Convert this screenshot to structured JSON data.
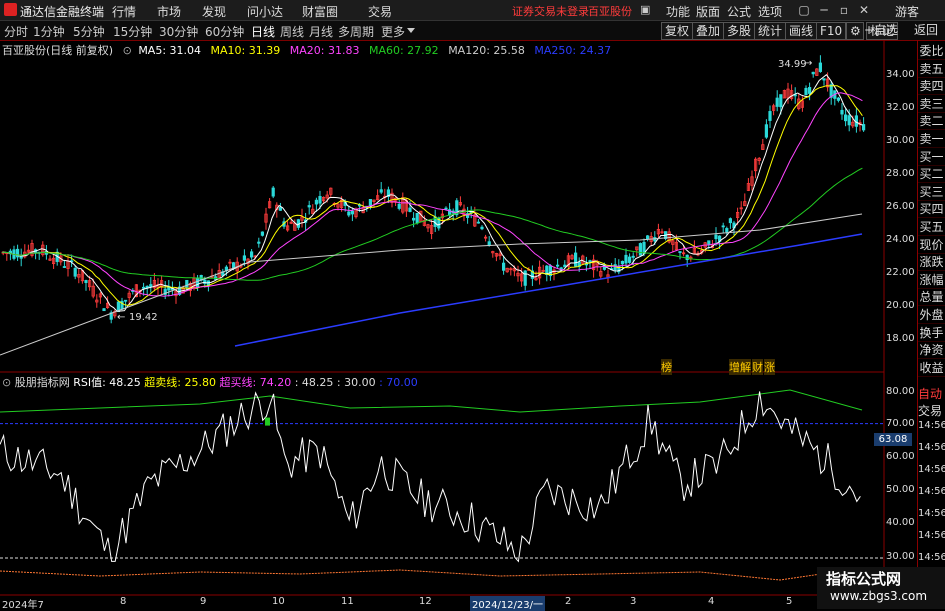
{
  "app": {
    "title": "通达信金融终端"
  },
  "menu": [
    "行情",
    "市场",
    "发现",
    "问小达",
    "财富圈",
    "交易"
  ],
  "warning": "证券交易未登录",
  "stock_name": "百亚股份",
  "top_right_menu": [
    "功能",
    "版面",
    "公式",
    "选项"
  ],
  "guest": "游客",
  "window_buttons": [
    "▢",
    "─",
    "▫",
    "✕"
  ],
  "periods": [
    "分时",
    "1分钟",
    "5分钟",
    "15分钟",
    "30分钟",
    "60分钟",
    "日线",
    "周线",
    "月线",
    "多周期",
    "更多"
  ],
  "active_period": "日线",
  "right_tools": [
    "复权",
    "叠加",
    "多股",
    "统计",
    "画线",
    "F10",
    "标记",
    "+自选",
    "返回"
  ],
  "settings_icon": "gear-icon",
  "info": {
    "title": "百亚股份(日线 前复权)",
    "ma5": "MA5: 31.04",
    "ma10": "MA10: 31.39",
    "ma20": "MA20: 31.83",
    "ma60": "MA60: 27.92",
    "ma120": "MA120: 25.58",
    "ma250": "MA250: 24.37"
  },
  "price_axis": [
    "34.00",
    "32.00",
    "30.00",
    "28.00",
    "26.00",
    "24.00",
    "22.00",
    "20.00",
    "18.00"
  ],
  "high_label": "34.99",
  "low_label": "19.42",
  "event_tags": [
    "榜",
    "增",
    "解",
    "财",
    "涨"
  ],
  "rsi_info": {
    "name": "股朋指标网",
    "value": "RSI值: 48.25",
    "oversold": "超卖线: 25.80",
    "overbought": "超买线: 74.20",
    "rest": ": 48.25 : 30.00",
    "tail": ": 70.00"
  },
  "rsi_axis": [
    "80.00",
    "70.00",
    "60.00",
    "50.00",
    "40.00",
    "30.00"
  ],
  "rsi_marker": "63.08",
  "time_labels": [
    "14:56",
    "14:56",
    "14:56",
    "14:56",
    "14:56",
    "14:56",
    "14:56"
  ],
  "x_labels": [
    "2024年7",
    "8",
    "9",
    "10",
    "11",
    "12",
    "2024/12/23/一",
    "2",
    "3",
    "4",
    "5"
  ],
  "side_panel": [
    "委比",
    "卖五",
    "卖四",
    "卖三",
    "卖二",
    "卖一",
    "买一",
    "买二",
    "买三",
    "买四",
    "买五",
    "现价",
    "涨跌",
    "涨幅",
    "总量",
    "外盘",
    "换手",
    "净资",
    "收益"
  ],
  "side_bottom": [
    "自动",
    "交易"
  ],
  "watermark": {
    "line1": "指标公式网",
    "line2": "www.zbgs3.com"
  },
  "colors": {
    "ma5": "#ffffff",
    "ma10": "#ffff00",
    "ma20": "#ff44ff",
    "ma60": "#22cc22",
    "ma120": "#cccccc",
    "ma250": "#2b3cff",
    "up": "#ff3c3c",
    "down": "#2bd9d9",
    "warning": "#ff3b3b"
  }
}
